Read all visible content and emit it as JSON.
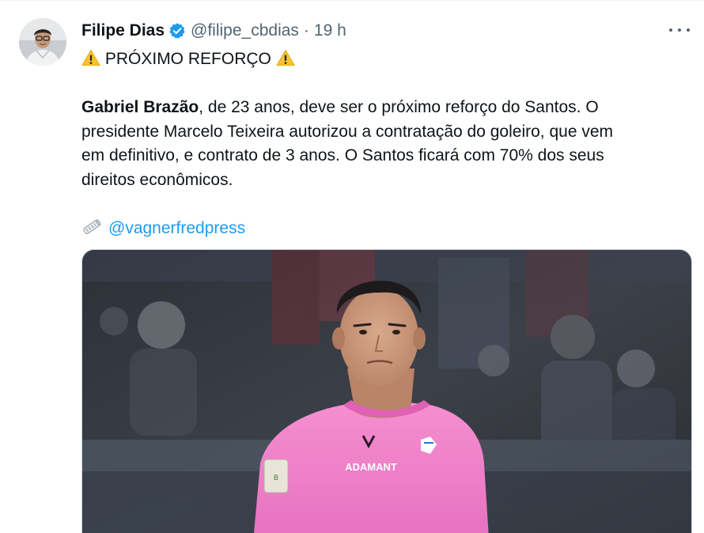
{
  "tweet": {
    "author": {
      "display_name": "Filipe Dias",
      "handle": "@filipe_cbdias",
      "separator": "·",
      "time": "19 h",
      "verified": true
    },
    "title_line": "PRÓXIMO REFORÇO",
    "body": {
      "lead_bold": "Gabriel Brazão",
      "line1_rest": ", de 23 anos, deve ser o próximo reforço do Santos. O",
      "line2": "presidente Marcelo Teixeira autorizou a contratação do goleiro, que vem",
      "line3": "em definitivo, e contrato de 3 anos.  O Santos ficará com 70% dos seus",
      "line4": "direitos econômicos."
    },
    "mention": "@vagnerfredpress",
    "media": {
      "jersey_text": "ADAMANT"
    },
    "icons": {
      "warning": "warning-icon",
      "verified": "verified-badge-icon",
      "newspaper": "rolled-newspaper-icon",
      "more": "more-options-icon"
    }
  },
  "colors": {
    "link": "#1d9bf0",
    "muted": "#536471",
    "text": "#0f1419",
    "jersey": "#f17fc9"
  }
}
